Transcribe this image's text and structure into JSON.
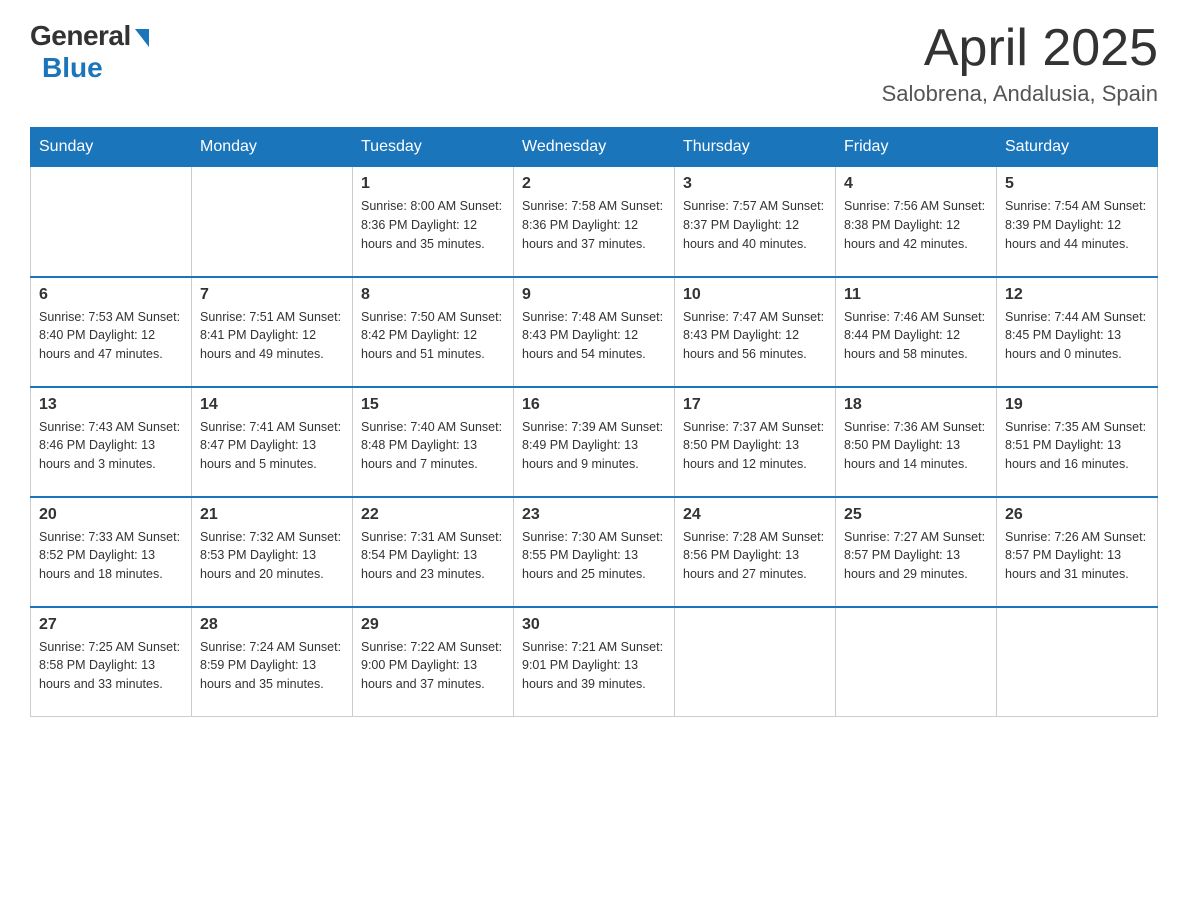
{
  "header": {
    "logo": {
      "general": "General",
      "blue": "Blue"
    },
    "title": "April 2025",
    "location": "Salobrena, Andalusia, Spain"
  },
  "calendar": {
    "days_of_week": [
      "Sunday",
      "Monday",
      "Tuesday",
      "Wednesday",
      "Thursday",
      "Friday",
      "Saturday"
    ],
    "weeks": [
      [
        {
          "day": "",
          "info": ""
        },
        {
          "day": "",
          "info": ""
        },
        {
          "day": "1",
          "info": "Sunrise: 8:00 AM\nSunset: 8:36 PM\nDaylight: 12 hours\nand 35 minutes."
        },
        {
          "day": "2",
          "info": "Sunrise: 7:58 AM\nSunset: 8:36 PM\nDaylight: 12 hours\nand 37 minutes."
        },
        {
          "day": "3",
          "info": "Sunrise: 7:57 AM\nSunset: 8:37 PM\nDaylight: 12 hours\nand 40 minutes."
        },
        {
          "day": "4",
          "info": "Sunrise: 7:56 AM\nSunset: 8:38 PM\nDaylight: 12 hours\nand 42 minutes."
        },
        {
          "day": "5",
          "info": "Sunrise: 7:54 AM\nSunset: 8:39 PM\nDaylight: 12 hours\nand 44 minutes."
        }
      ],
      [
        {
          "day": "6",
          "info": "Sunrise: 7:53 AM\nSunset: 8:40 PM\nDaylight: 12 hours\nand 47 minutes."
        },
        {
          "day": "7",
          "info": "Sunrise: 7:51 AM\nSunset: 8:41 PM\nDaylight: 12 hours\nand 49 minutes."
        },
        {
          "day": "8",
          "info": "Sunrise: 7:50 AM\nSunset: 8:42 PM\nDaylight: 12 hours\nand 51 minutes."
        },
        {
          "day": "9",
          "info": "Sunrise: 7:48 AM\nSunset: 8:43 PM\nDaylight: 12 hours\nand 54 minutes."
        },
        {
          "day": "10",
          "info": "Sunrise: 7:47 AM\nSunset: 8:43 PM\nDaylight: 12 hours\nand 56 minutes."
        },
        {
          "day": "11",
          "info": "Sunrise: 7:46 AM\nSunset: 8:44 PM\nDaylight: 12 hours\nand 58 minutes."
        },
        {
          "day": "12",
          "info": "Sunrise: 7:44 AM\nSunset: 8:45 PM\nDaylight: 13 hours\nand 0 minutes."
        }
      ],
      [
        {
          "day": "13",
          "info": "Sunrise: 7:43 AM\nSunset: 8:46 PM\nDaylight: 13 hours\nand 3 minutes."
        },
        {
          "day": "14",
          "info": "Sunrise: 7:41 AM\nSunset: 8:47 PM\nDaylight: 13 hours\nand 5 minutes."
        },
        {
          "day": "15",
          "info": "Sunrise: 7:40 AM\nSunset: 8:48 PM\nDaylight: 13 hours\nand 7 minutes."
        },
        {
          "day": "16",
          "info": "Sunrise: 7:39 AM\nSunset: 8:49 PM\nDaylight: 13 hours\nand 9 minutes."
        },
        {
          "day": "17",
          "info": "Sunrise: 7:37 AM\nSunset: 8:50 PM\nDaylight: 13 hours\nand 12 minutes."
        },
        {
          "day": "18",
          "info": "Sunrise: 7:36 AM\nSunset: 8:50 PM\nDaylight: 13 hours\nand 14 minutes."
        },
        {
          "day": "19",
          "info": "Sunrise: 7:35 AM\nSunset: 8:51 PM\nDaylight: 13 hours\nand 16 minutes."
        }
      ],
      [
        {
          "day": "20",
          "info": "Sunrise: 7:33 AM\nSunset: 8:52 PM\nDaylight: 13 hours\nand 18 minutes."
        },
        {
          "day": "21",
          "info": "Sunrise: 7:32 AM\nSunset: 8:53 PM\nDaylight: 13 hours\nand 20 minutes."
        },
        {
          "day": "22",
          "info": "Sunrise: 7:31 AM\nSunset: 8:54 PM\nDaylight: 13 hours\nand 23 minutes."
        },
        {
          "day": "23",
          "info": "Sunrise: 7:30 AM\nSunset: 8:55 PM\nDaylight: 13 hours\nand 25 minutes."
        },
        {
          "day": "24",
          "info": "Sunrise: 7:28 AM\nSunset: 8:56 PM\nDaylight: 13 hours\nand 27 minutes."
        },
        {
          "day": "25",
          "info": "Sunrise: 7:27 AM\nSunset: 8:57 PM\nDaylight: 13 hours\nand 29 minutes."
        },
        {
          "day": "26",
          "info": "Sunrise: 7:26 AM\nSunset: 8:57 PM\nDaylight: 13 hours\nand 31 minutes."
        }
      ],
      [
        {
          "day": "27",
          "info": "Sunrise: 7:25 AM\nSunset: 8:58 PM\nDaylight: 13 hours\nand 33 minutes."
        },
        {
          "day": "28",
          "info": "Sunrise: 7:24 AM\nSunset: 8:59 PM\nDaylight: 13 hours\nand 35 minutes."
        },
        {
          "day": "29",
          "info": "Sunrise: 7:22 AM\nSunset: 9:00 PM\nDaylight: 13 hours\nand 37 minutes."
        },
        {
          "day": "30",
          "info": "Sunrise: 7:21 AM\nSunset: 9:01 PM\nDaylight: 13 hours\nand 39 minutes."
        },
        {
          "day": "",
          "info": ""
        },
        {
          "day": "",
          "info": ""
        },
        {
          "day": "",
          "info": ""
        }
      ]
    ]
  }
}
